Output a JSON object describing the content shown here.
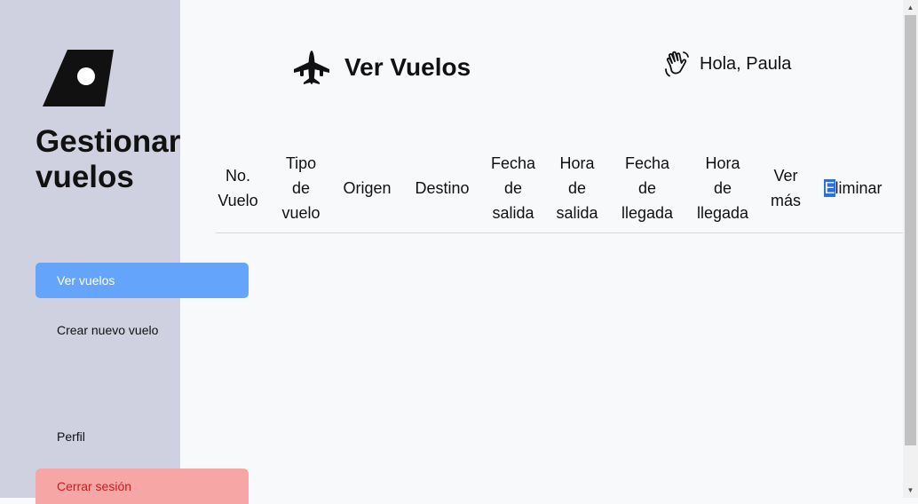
{
  "sidebar": {
    "logo_icon": "plane-tail-logo",
    "title": "Gestionar vuelos",
    "items": [
      {
        "label": "Ver vuelos",
        "active": true
      },
      {
        "label": "Crear nuevo vuelo"
      },
      {
        "label": "Perfil"
      },
      {
        "label": "Cerrar sesión"
      }
    ]
  },
  "header": {
    "icon": "airplane-icon",
    "title": "Ver Vuelos",
    "greeting_icon": "waving-hand-icon",
    "greeting": "Hola, Paula"
  },
  "table": {
    "columns": [
      "No. Vuelo",
      "Tipo de vuelo",
      "Origen",
      "Destino",
      "Fecha de salida",
      "Hora de salida",
      "Fecha de llegada",
      "Hora de llegada",
      "Ver más",
      "Eliminar"
    ],
    "col_parts": {
      "c0": [
        "No.",
        "Vuelo"
      ],
      "c1": [
        "Tipo",
        "de",
        "vuelo"
      ],
      "c4": [
        "Fecha",
        "de",
        "salida"
      ],
      "c5": [
        "Hora",
        "de",
        "salida"
      ],
      "c6": [
        "Fecha",
        "de",
        "llegada"
      ],
      "c7": [
        "Hora",
        "de",
        "llegada"
      ],
      "c8": [
        "Ver",
        "más"
      ],
      "c9": [
        "E",
        "liminar"
      ]
    },
    "rows": []
  },
  "colors": {
    "sidebar_bg": "#cfd0e0",
    "active_nav": "#64a4fb",
    "logout_bg": "#f7a6a6",
    "logout_text": "#c81e1e",
    "page_bg": "#f8f9fb"
  }
}
